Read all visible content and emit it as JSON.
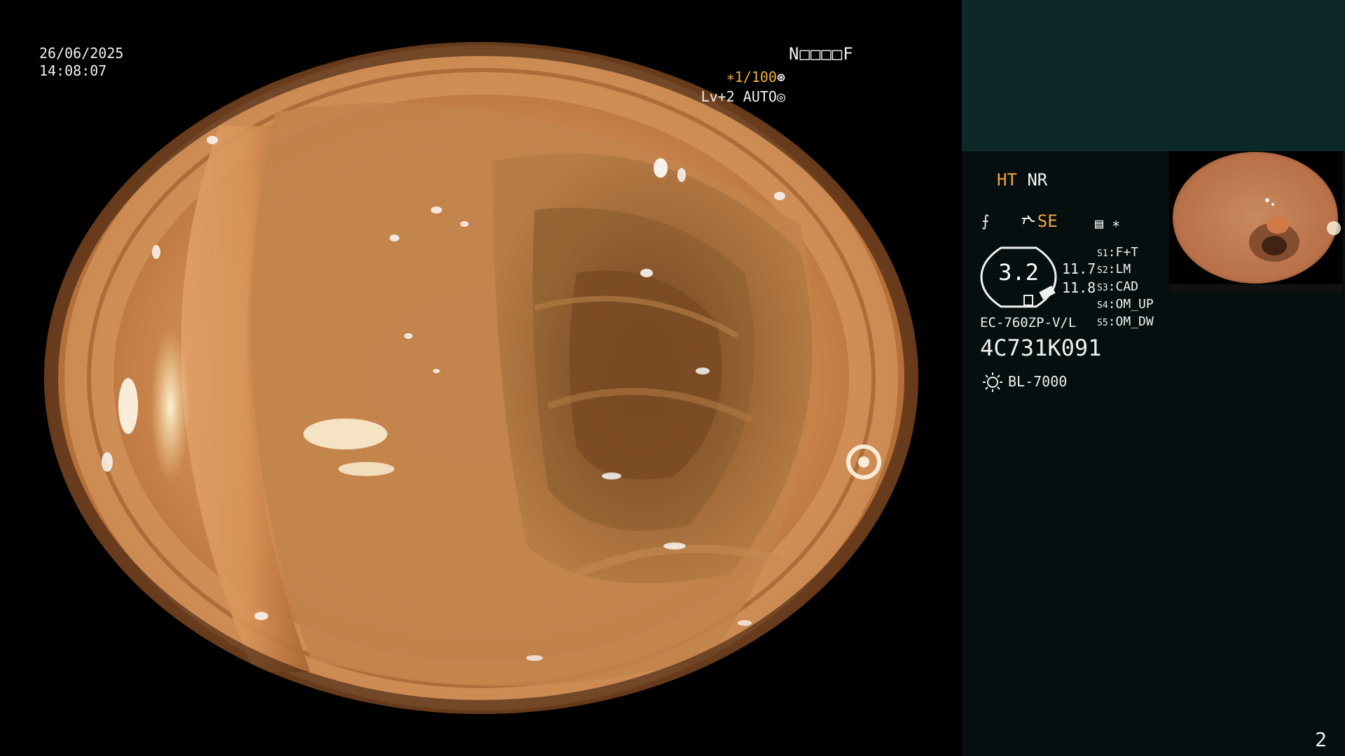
{
  "overlay": {
    "date": "26/06/2025",
    "time": "14:08:07",
    "patient_id": "N□□□□F",
    "shutter": "∗1/100",
    "shutter_icon": "⊛",
    "iris": "Lv+2 AUTO",
    "iris_icon": "◎"
  },
  "panel": {
    "ht": "HT",
    "nr": "NR",
    "se": "SE",
    "enh_icon": "⨍",
    "mem_icon": "▤ ∗",
    "zoom": "3.2",
    "fn_value_1": "11.7",
    "fn_value_2": "11.8",
    "switches": [
      {
        "key": "S1",
        "value": "F+T"
      },
      {
        "key": "S2",
        "value": "LM"
      },
      {
        "key": "S3",
        "value": "CAD"
      },
      {
        "key": "S4",
        "value": "OM_UP"
      },
      {
        "key": "S5",
        "value": "OM_DW"
      }
    ],
    "scope_model": "EC-760ZP-V/L",
    "scope_serial": "4C731K091",
    "light_source": "BL-7000",
    "page_number": "2"
  },
  "colors": {
    "panel_top": "#0d2828",
    "panel_bg": "#060f0f",
    "accent": "#f2a63a"
  }
}
